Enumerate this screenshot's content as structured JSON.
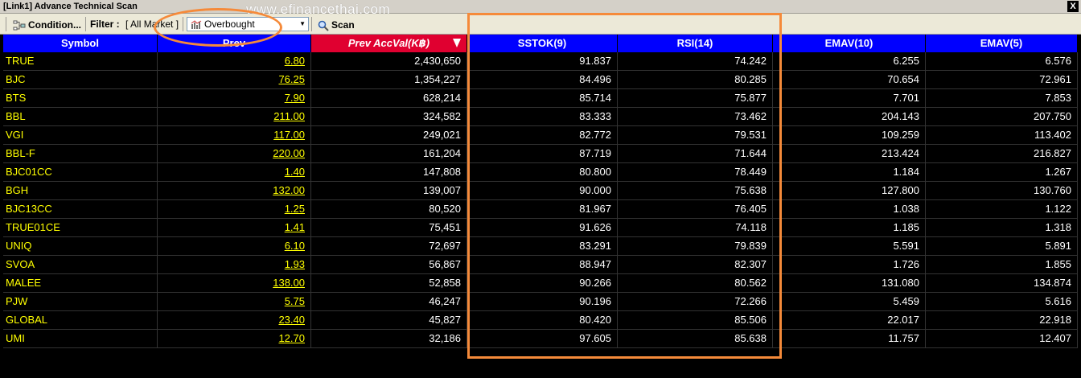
{
  "window": {
    "title": "[Link1] Advance Technical Scan",
    "close_label": "X"
  },
  "watermark": "www.efinancethai.com",
  "toolbar": {
    "condition_label": "Condition...",
    "filter_label": "Filter :",
    "filter_value": "[ All Market ]",
    "scan_type": "Overbought",
    "scan_label": "Scan"
  },
  "table": {
    "columns": [
      "Symbol",
      "Prev",
      "Prev AccVal(K฿)",
      "SSTOK(9)",
      "RSI(14)",
      "EMAV(10)",
      "EMAV(5)"
    ],
    "sorted_column": 2,
    "rows": [
      [
        "TRUE",
        "6.80",
        "2,430,650",
        "91.837",
        "74.242",
        "6.255",
        "6.576"
      ],
      [
        "BJC",
        "76.25",
        "1,354,227",
        "84.496",
        "80.285",
        "70.654",
        "72.961"
      ],
      [
        "BTS",
        "7.90",
        "628,214",
        "85.714",
        "75.877",
        "7.701",
        "7.853"
      ],
      [
        "BBL",
        "211.00",
        "324,582",
        "83.333",
        "73.462",
        "204.143",
        "207.750"
      ],
      [
        "VGI",
        "117.00",
        "249,021",
        "82.772",
        "79.531",
        "109.259",
        "113.402"
      ],
      [
        "BBL-F",
        "220.00",
        "161,204",
        "87.719",
        "71.644",
        "213.424",
        "216.827"
      ],
      [
        "BJC01CC",
        "1.40",
        "147,808",
        "80.800",
        "78.449",
        "1.184",
        "1.267"
      ],
      [
        "BGH",
        "132.00",
        "139,007",
        "90.000",
        "75.638",
        "127.800",
        "130.760"
      ],
      [
        "BJC13CC",
        "1.25",
        "80,520",
        "81.967",
        "76.405",
        "1.038",
        "1.122"
      ],
      [
        "TRUE01CE",
        "1.41",
        "75,451",
        "91.626",
        "74.118",
        "1.185",
        "1.318"
      ],
      [
        "UNIQ",
        "6.10",
        "72,697",
        "83.291",
        "79.839",
        "5.591",
        "5.891"
      ],
      [
        "SVOA",
        "1.93",
        "56,867",
        "88.947",
        "82.307",
        "1.726",
        "1.855"
      ],
      [
        "MALEE",
        "138.00",
        "52,858",
        "90.266",
        "80.562",
        "131.080",
        "134.874"
      ],
      [
        "PJW",
        "5.75",
        "46,247",
        "90.196",
        "72.266",
        "5.459",
        "5.616"
      ],
      [
        "GLOBAL",
        "23.40",
        "45,827",
        "80.420",
        "85.506",
        "22.017",
        "22.918"
      ],
      [
        "UMI",
        "12.70",
        "32,186",
        "97.605",
        "85.638",
        "11.757",
        "12.407"
      ]
    ]
  },
  "colors": {
    "header_bg": "#0000ff",
    "sorted_header_bg": "#e00030",
    "symbol_text": "#ffff00",
    "value_text": "#ffffff",
    "annotation": "#f58a3a"
  }
}
